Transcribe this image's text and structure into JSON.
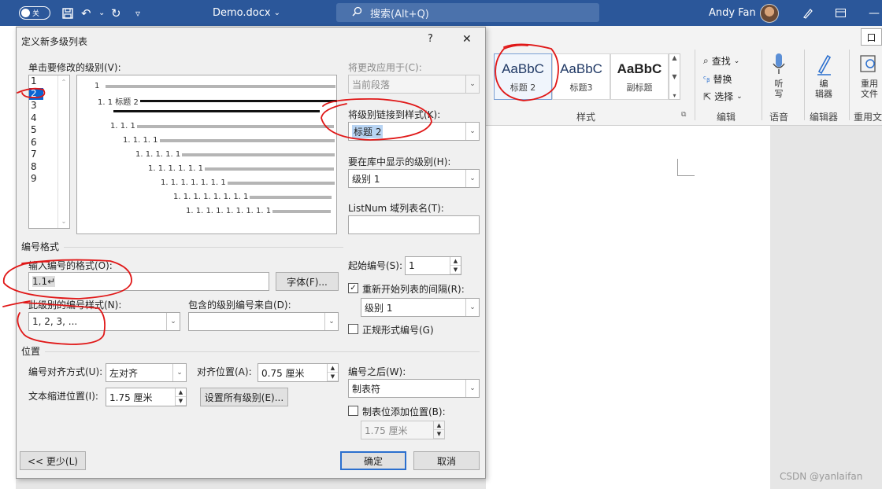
{
  "titlebar": {
    "autosave_toggle": "关",
    "doc_name": "Demo.docx",
    "search_placeholder": "搜索(Alt+Q)",
    "user_name": "Andy Fan"
  },
  "ribbon": {
    "share_label": "口",
    "styles": [
      {
        "sample": "AaBbC",
        "name": "标题 2"
      },
      {
        "sample": "AaBbC",
        "name": "标题3"
      },
      {
        "sample": "AaBbC",
        "name": "副标题"
      }
    ],
    "find": "查找",
    "replace": "替换",
    "select": "选择",
    "dictate_line1": "听",
    "dictate_line2": "写",
    "editor_line1": "编",
    "editor_line2": "辑器",
    "reuse_line1": "重用",
    "reuse_line2": "文件",
    "group_styles": "样式",
    "group_editing": "编辑",
    "group_voice": "语音",
    "group_editor": "编辑器",
    "group_reuse": "重用文"
  },
  "dialog": {
    "title": "定义新多级列表",
    "help": "?",
    "close": "✕",
    "level_label": "单击要修改的级别(V):",
    "levels": [
      "1",
      "2",
      "3",
      "4",
      "5",
      "6",
      "7",
      "8",
      "9"
    ],
    "apply_to_label": "将更改应用于(C):",
    "apply_to_value": "当前段落",
    "link_style_label": "将级别链接到样式(K):",
    "link_style_value": "标题 2",
    "gallery_level_label": "要在库中显示的级别(H):",
    "gallery_level_value": "级别 1",
    "listnum_label": "ListNum 域列表名(T):",
    "listnum_value": "",
    "preview": {
      "rows": [
        "1",
        "1. 1 标题 2",
        "",
        "1. 1. 1",
        "1. 1. 1. 1",
        "1. 1. 1. 1. 1",
        "1. 1. 1. 1. 1. 1",
        "1. 1. 1. 1. 1. 1. 1",
        "1. 1. 1. 1. 1. 1. 1. 1",
        "1. 1. 1. 1. 1. 1. 1. 1. 1"
      ]
    },
    "number_format_section": "编号格式",
    "enter_format_label": "输入编号的格式(O):",
    "format_value": "1.1↵",
    "font_button": "字体(F)...",
    "number_style_label": "此级别的编号样式(N):",
    "number_style_value": "1, 2, 3, ...",
    "include_from_label": "包含的级别编号来自(D):",
    "include_from_value": "",
    "start_at_label": "起始编号(S):",
    "start_at_value": "1",
    "restart_label": "重新开始列表的间隔(R):",
    "restart_checked": "✓",
    "restart_value": "级别 1",
    "legal_label": "正规形式编号(G)",
    "position_section": "位置",
    "alignment_label": "编号对齐方式(U):",
    "alignment_value": "左对齐",
    "aligned_at_label": "对齐位置(A):",
    "aligned_at_value": "0.75 厘米",
    "indent_label": "文本缩进位置(I):",
    "indent_value": "1.75 厘米",
    "set_all_button": "设置所有级别(E)...",
    "follow_label": "编号之后(W):",
    "follow_value": "制表符",
    "tab_stop_label": "制表位添加位置(B):",
    "tab_stop_value": "1.75 厘米",
    "less_button": "<< 更少(L)",
    "ok_button": "确定",
    "cancel_button": "取消"
  },
  "watermark": "CSDN @yanlaifan",
  "colors": {
    "title_bar": "#2b579a",
    "selection": "#0a64d3",
    "annotation": "#e01818",
    "ok_border": "#2b6fce"
  }
}
